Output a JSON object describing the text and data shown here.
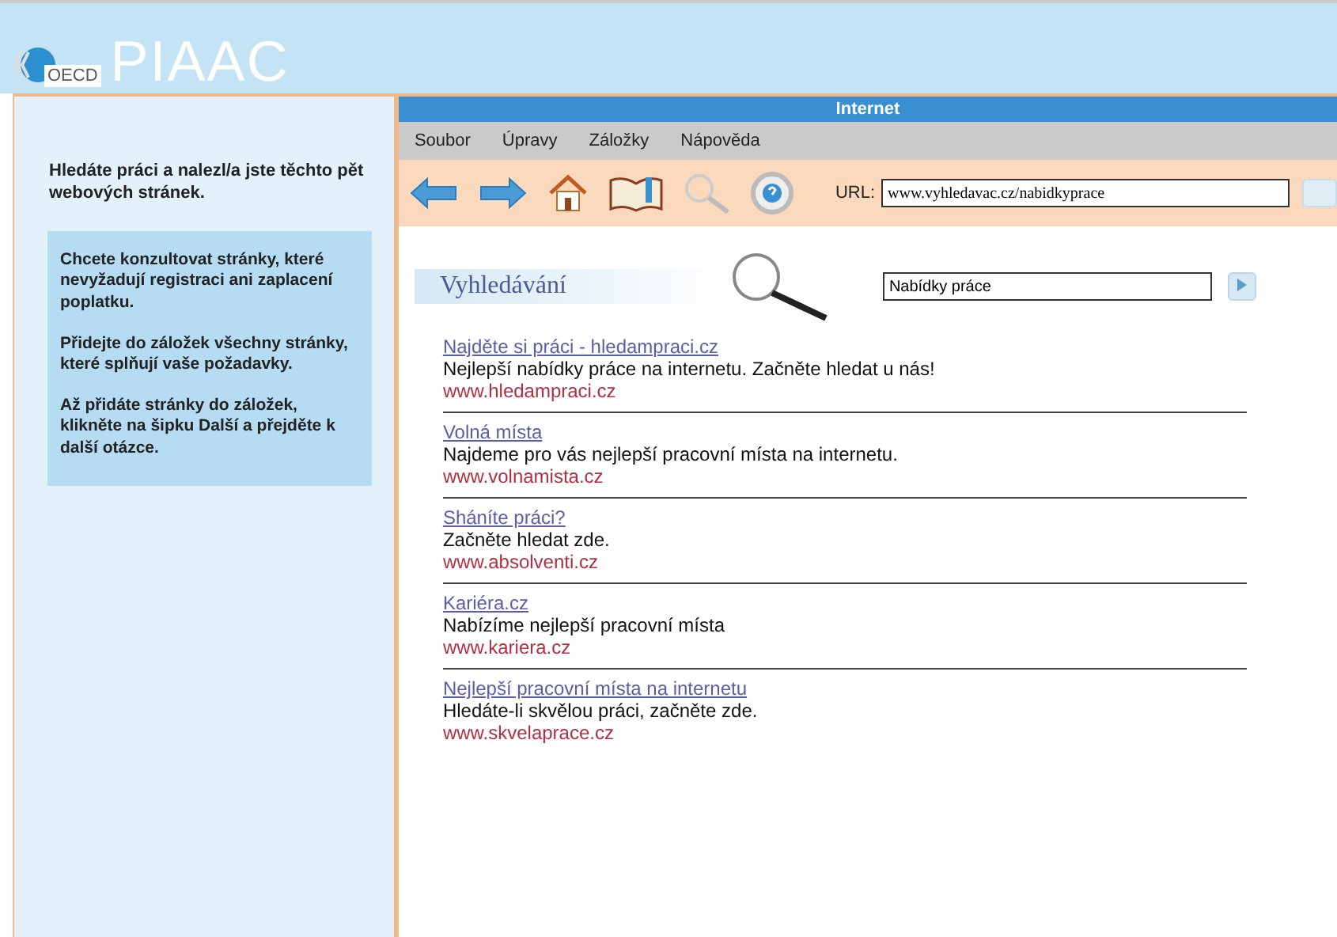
{
  "logo": {
    "org": "OECD",
    "name": "PIAAC"
  },
  "instructions": {
    "intro": "Hledáte práci a nalezl/a jste těchto pět webových stránek.",
    "task": [
      "Chcete konzultovat stránky, které nevyžadují registraci ani zaplacení poplatku.",
      "Přidejte do záložek všechny stránky, které splňují vaše požadavky.",
      "Až přidáte stránky do záložek, klikněte na šipku Další a přejděte k další otázce."
    ]
  },
  "browser": {
    "title": "Internet",
    "menu": [
      "Soubor",
      "Úpravy",
      "Záložky",
      "Nápověda"
    ],
    "url_label": "URL:",
    "url": "www.vyhledavac.cz/nabidkyprace"
  },
  "search": {
    "heading": "Vyhledávání",
    "value": "Nabídky práce"
  },
  "results": [
    {
      "title": "Najděte si práci - hledampraci.cz",
      "description": "Nejlepší nabídky práce na internetu. Začněte hledat u nás!",
      "url": "www.hledampraci.cz"
    },
    {
      "title": "Volná místa",
      "description": "Najdeme pro vás nejlepší pracovní místa na internetu.",
      "url": "www.volnamista.cz"
    },
    {
      "title": "Sháníte práci?",
      "description": "Začněte hledat zde.",
      "url": "www.absolventi.cz"
    },
    {
      "title": "Kariéra.cz",
      "description": "Nabízíme nejlepší pracovní místa",
      "url": "www.kariera.cz"
    },
    {
      "title": "Nejlepší pracovní místa na internetu",
      "description": "Hledáte-li skvělou práci, začněte zde.",
      "url": "www.skvelaprace.cz"
    }
  ]
}
